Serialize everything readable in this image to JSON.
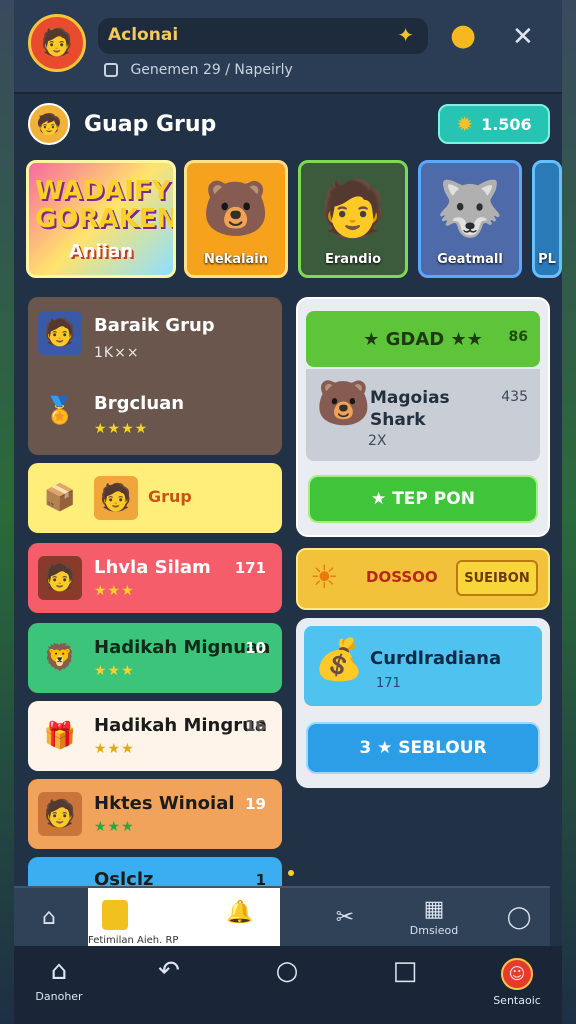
{
  "header": {
    "player_name": "Aclonai",
    "sub_label": "Genemen",
    "sub_value": "29",
    "sub_extra": "/ Napeirly"
  },
  "group": {
    "title": "Guap Grup",
    "coins": "1.506"
  },
  "cards": [
    {
      "big": "WADAIFY\nGORAKEN",
      "small": "Aniian"
    },
    {
      "label": "Nekalain"
    },
    {
      "label": "Erandio"
    },
    {
      "label": "Geatmall"
    },
    {
      "label": "PL"
    }
  ],
  "list": [
    {
      "title": "Baraik Grup",
      "sub": "1K××"
    },
    {
      "title": "Brgcluan",
      "stars": "★★★★"
    },
    {
      "title": "Grup"
    },
    {
      "title": "Lhvla Silam",
      "stars": "★★★",
      "num": "171"
    },
    {
      "title": "Hadikah Mignuaa",
      "stars": "★★★",
      "num": "10"
    },
    {
      "title": "Hadikah Mingrua",
      "stars": "★★★",
      "num": "16"
    },
    {
      "title": "Hktes Winoial",
      "stars": "★★★",
      "num": "19"
    },
    {
      "title": "Oslclz",
      "num": "1"
    }
  ],
  "panel": {
    "header": "★ GDAD ★★",
    "header_right": "86",
    "item_title": "Magoias\nShark",
    "item_num": "435",
    "item_x": "2X",
    "button": "★ TEP PON"
  },
  "offer": {
    "label": "DOSSOO",
    "button": "SUEIBON"
  },
  "blue": {
    "title": "Curdlradiana",
    "sub": "171",
    "button": "3 ★ SEBLOUR"
  },
  "tabs": {
    "right_label": "Dmsieod",
    "active_sub": "Fetimilan Aieh. RP"
  },
  "nav": {
    "left_label": "Danoher",
    "right_label": "Sentaoic"
  }
}
